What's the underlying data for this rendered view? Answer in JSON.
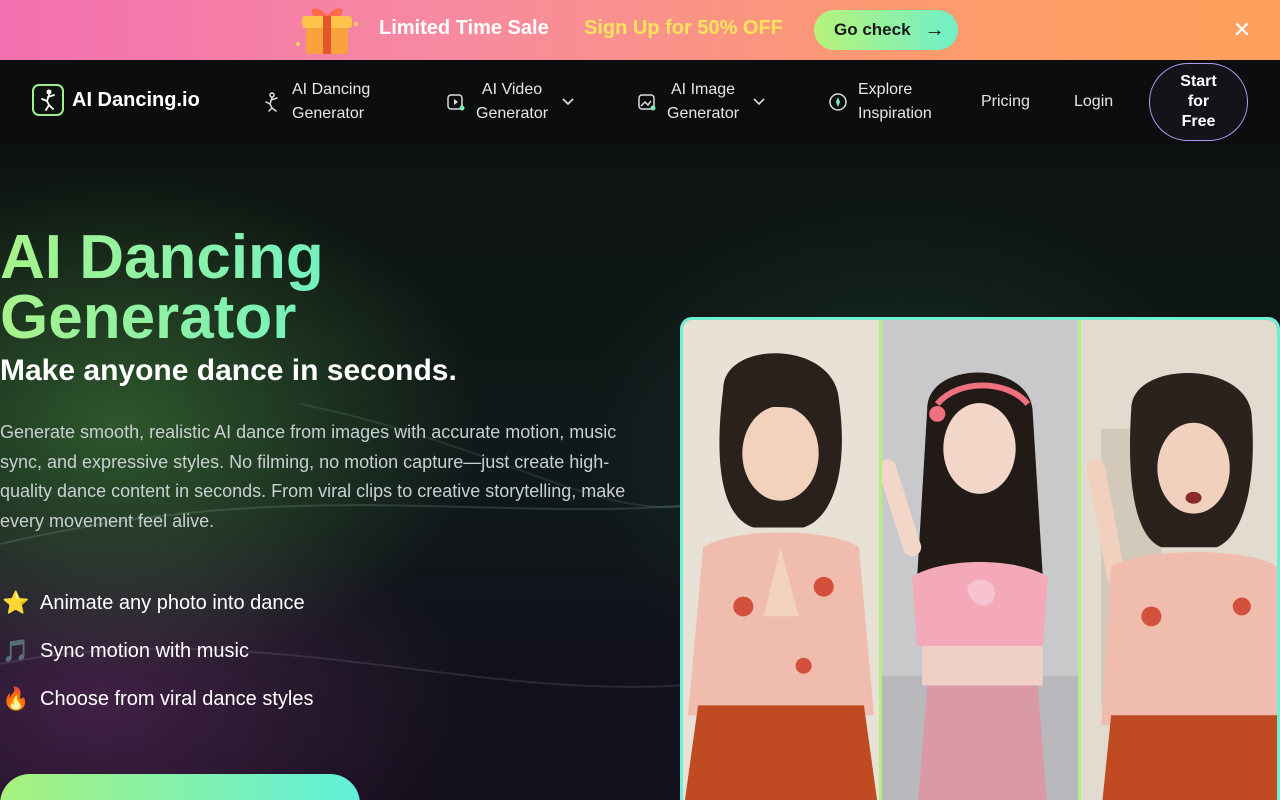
{
  "promo": {
    "sale_text": "Limited Time Sale",
    "signup_text": "Sign Up for 50% OFF",
    "button_label": "Go check",
    "button_arrow": "→",
    "close_symbol": "✕"
  },
  "nav": {
    "logo_text": "AI Dancing.io",
    "items": [
      {
        "line1": "AI Dancing",
        "line2": "Generator",
        "icon": "dancer-icon"
      },
      {
        "line1": "AI Video",
        "line2": "Generator",
        "icon": "video-icon",
        "dropdown": true
      },
      {
        "line1": "AI Image",
        "line2": "Generator",
        "icon": "image-icon",
        "dropdown": true
      },
      {
        "line1": "Explore",
        "line2": "Inspiration",
        "icon": "compass-icon"
      }
    ],
    "pricing": "Pricing",
    "login": "Login",
    "start": [
      "Start",
      "for",
      "Free"
    ]
  },
  "hero": {
    "title_line1": "AI Dancing",
    "title_line2": "Generator",
    "subtitle": "Make anyone dance in seconds.",
    "description": "Generate smooth, realistic AI dance from images with accurate motion, music sync, and expressive styles. No filming, no motion capture—just create high-quality dance content in seconds. From viral clips to creative storytelling, make every movement feel alive.",
    "features": [
      {
        "emoji": "⭐",
        "text": "Animate any photo into dance"
      },
      {
        "emoji": "🎵",
        "text": "Sync motion with music"
      },
      {
        "emoji": "🔥",
        "text": "Choose from viral dance styles"
      }
    ]
  },
  "colors": {
    "accent_green": "#a7f38b",
    "accent_teal": "#6ef0c5",
    "sale_yellow": "#ffe45c",
    "start_border": "#b69bf4"
  }
}
